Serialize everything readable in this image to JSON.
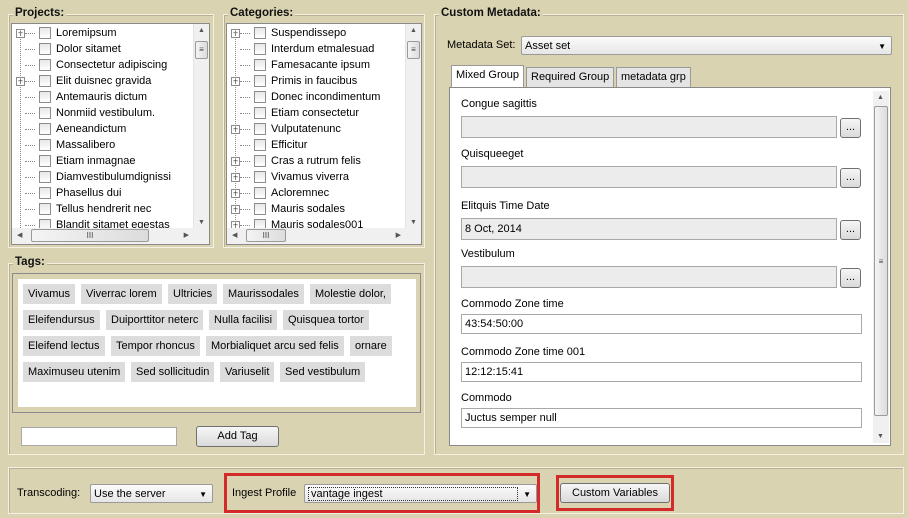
{
  "projects": {
    "title": "Projects:",
    "items": [
      {
        "label": "Loremipsum",
        "expandable": true
      },
      {
        "label": "Dolor sitamet",
        "expandable": false
      },
      {
        "label": "Consectetur adipiscing",
        "expandable": false
      },
      {
        "label": "Elit duisnec gravida",
        "expandable": true
      },
      {
        "label": "Antemauris dictum",
        "expandable": false
      },
      {
        "label": "Nonmiid vestibulum.",
        "expandable": false
      },
      {
        "label": "Aeneandictum",
        "expandable": false
      },
      {
        "label": "Massalibero",
        "expandable": false
      },
      {
        "label": "Etiam inmagnae",
        "expandable": false
      },
      {
        "label": "Diamvestibulumdignissi",
        "expandable": false
      },
      {
        "label": "Phasellus dui",
        "expandable": false
      },
      {
        "label": "Tellus hendrerit nec",
        "expandable": false
      },
      {
        "label": "Blandit sitamet egestas",
        "expandable": false
      }
    ]
  },
  "categories": {
    "title": "Categories:",
    "items": [
      {
        "label": "Suspendissepo",
        "expandable": true
      },
      {
        "label": "Interdum etmalesuad",
        "expandable": false
      },
      {
        "label": "Famesacante ipsum",
        "expandable": false
      },
      {
        "label": "Primis in faucibus",
        "expandable": true
      },
      {
        "label": "Donec incondimentum",
        "expandable": false
      },
      {
        "label": "Etiam consectetur",
        "expandable": false
      },
      {
        "label": "Vulputatenunc",
        "expandable": true
      },
      {
        "label": "Efficitur",
        "expandable": false
      },
      {
        "label": "Cras a rutrum felis",
        "expandable": true
      },
      {
        "label": "Vivamus viverra",
        "expandable": true
      },
      {
        "label": "Acloremnec",
        "expandable": true
      },
      {
        "label": "Mauris sodales",
        "expandable": true
      },
      {
        "label": "Mauris sodales001",
        "expandable": true
      }
    ]
  },
  "tags": {
    "title": "Tags:",
    "rows": [
      [
        "Vivamus",
        "Viverrac lorem",
        "Ultricies",
        "Maurissodales",
        "Molestie dolor,"
      ],
      [
        "Eleifendursus",
        "Duiporttitor neterc",
        "Nulla facilisi",
        "Quisquea tortor"
      ],
      [
        "Eleifend lectus",
        "Tempor rhoncus",
        "Morbialiquet arcu sed felis",
        "ornare"
      ],
      [
        "Maximuseu utenim",
        "Sed sollicitudin",
        "Variuselit",
        "Sed vestibulum"
      ]
    ],
    "new_tag_value": "",
    "add_tag_label": "Add Tag"
  },
  "metadata": {
    "title": "Custom Metadata:",
    "set_label": "Metadata Set:",
    "set_value": "Asset set",
    "tabs": [
      "Mixed Group",
      "Required Group",
      "metadata grp"
    ],
    "active_tab": 0,
    "fields": [
      {
        "label": "Congue sagittis",
        "value": "",
        "browse": true
      },
      {
        "label": "Quisqueeget",
        "value": "",
        "browse": true
      },
      {
        "label": "Elitquis Time Date",
        "value": "8 Oct, 2014",
        "browse": true
      },
      {
        "label": "Vestibulum",
        "value": "",
        "browse": true
      },
      {
        "label": "Commodo Zone time",
        "value": "43:54:50:00",
        "browse": false
      },
      {
        "label": "Commodo Zone time 001",
        "value": "12:12:15:41",
        "browse": false
      },
      {
        "label": "Commodo",
        "value": "Juctus semper null",
        "browse": false
      }
    ],
    "browse_label": "..."
  },
  "bottom": {
    "transcoding_label": "Transcoding:",
    "transcoding_value": "Use the server",
    "ingest_label": "Ingest Profile",
    "ingest_value": "vantage ingest",
    "custom_variables_label": "Custom Variables",
    "highlight_color": "#d32a2a"
  }
}
